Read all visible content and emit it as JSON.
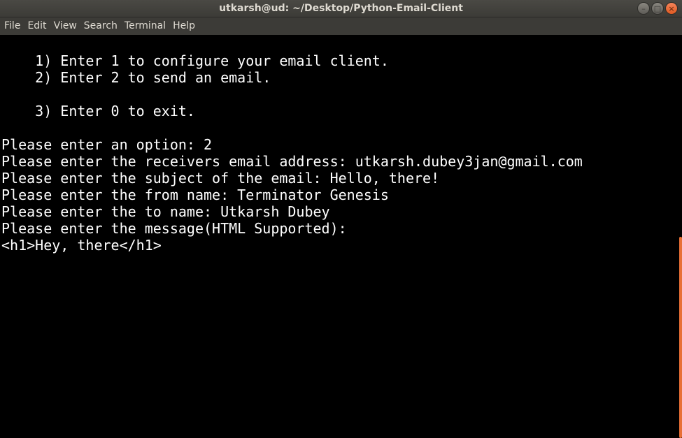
{
  "window": {
    "title": "utkarsh@ud: ~/Desktop/Python-Email-Client"
  },
  "menu": {
    "items": [
      "File",
      "Edit",
      "View",
      "Search",
      "Terminal",
      "Help"
    ]
  },
  "terminal": {
    "lines": [
      "    1) Enter 1 to configure your email client.",
      "    2) Enter 2 to send an email.",
      "",
      "    3) Enter 0 to exit.",
      "",
      "Please enter an option: 2",
      "Please enter the receivers email address: utkarsh.dubey3jan@gmail.com",
      "Please enter the subject of the email: Hello, there!",
      "Please enter the from name: Terminator Genesis",
      "Please enter the to name: Utkarsh Dubey",
      "Please enter the message(HTML Supported):",
      "<h1>Hey, there</h1>"
    ]
  },
  "colors": {
    "titlebar": "#3c3b37",
    "terminal_bg": "#000000",
    "terminal_fg": "#ffffff",
    "scroll_thumb": "#e86f35"
  }
}
